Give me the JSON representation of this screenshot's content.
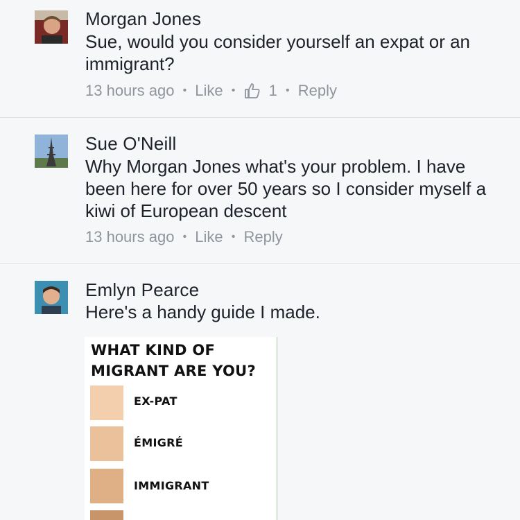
{
  "comments": [
    {
      "author": "Morgan Jones",
      "text": "Sue, would you consider yourself an expat or an immigrant?",
      "time": "13 hours ago",
      "like_label": "Like",
      "like_count": "1",
      "reply_label": "Reply"
    },
    {
      "author": "Sue O'Neill",
      "text": "Why Morgan Jones what's your problem. I have been here for over 50 years so I consider myself a kiwi of European descent",
      "time": "13 hours ago",
      "like_label": "Like",
      "reply_label": "Reply"
    },
    {
      "author": "Emlyn Pearce",
      "text": "Here's a handy guide I made.",
      "attachment": {
        "title_line1": "WHAT KIND OF",
        "title_line2": "MIGRANT ARE YOU?",
        "swatches": [
          {
            "label": "EX-PAT",
            "color": "#f3cfae"
          },
          {
            "label": "ÉMIGRÉ",
            "color": "#ebc19c"
          },
          {
            "label": "IMMIGRANT",
            "color": "#dfaf86"
          },
          {
            "label": "",
            "color": "#c8956a"
          }
        ]
      }
    }
  ],
  "colors": {
    "background": "#f6f7f9",
    "meta_text": "#90949c",
    "divider": "#dddfe2"
  }
}
